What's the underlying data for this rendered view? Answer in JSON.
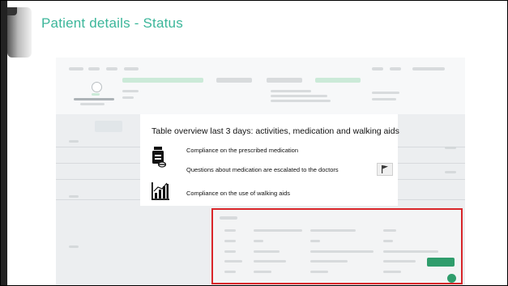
{
  "slide": {
    "title": "Patient details - Status"
  },
  "overview": {
    "title": "Table overview last 3 days: activities, medication and walking aids",
    "rows": [
      {
        "icon": "medication-icon",
        "text": "Compliance on the prescribed medication"
      },
      {
        "icon": "medication-icon",
        "text": "Questions about medication are escalated to the doctors"
      },
      {
        "icon": "bar-chart-icon",
        "text": "Compliance on the use of walking aids"
      }
    ]
  },
  "colors": {
    "title": "#3bb69a",
    "highlight_border": "#d9262a",
    "accent_green": "#2f9d6c"
  }
}
